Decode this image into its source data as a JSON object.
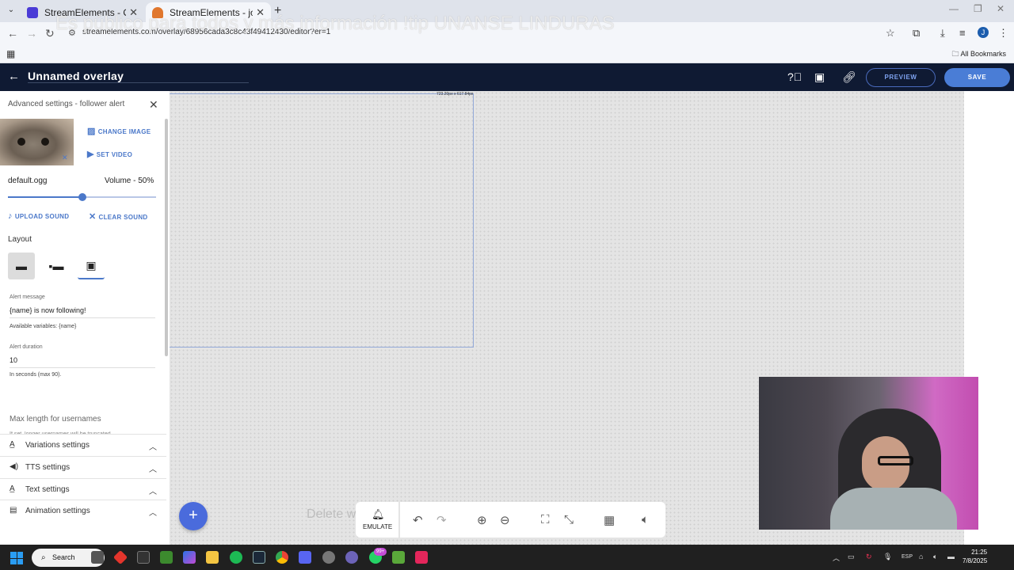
{
  "browser": {
    "tabs": [
      {
        "title": "StreamElements - Overlays",
        "favicon_color": "#4a3bd6"
      },
      {
        "title": "StreamElements - jorgitomix",
        "favicon_color": "#e0772e"
      }
    ],
    "new_tab": "+",
    "url": "streamelements.com/overlay/68956cada3c8c43f49412430/editor?er=1",
    "overlay_banner": "Es público para todos y más información !tip UNANSE LINDURAS",
    "bookmarks": {
      "all_label": "All Bookmarks"
    },
    "profile_initial": "J"
  },
  "app": {
    "overlay_title": "Unnamed overlay",
    "preview_label": "PREVIEW",
    "save_label": "SAVE"
  },
  "panel": {
    "title": "Advanced settings - follower alert",
    "change_image": "CHANGE IMAGE",
    "set_video": "SET VIDEO",
    "sound_name": "default.ogg",
    "volume_label": "Volume - 50%",
    "volume_fraction": 0.5,
    "upload_sound": "UPLOAD SOUND",
    "clear_sound": "CLEAR SOUND",
    "layout_heading": "Layout",
    "alert_message_label": "Alert message",
    "alert_message_value": "{name} is now following!",
    "alert_message_hint": "Available variables: {name}",
    "alert_duration_label": "Alert duration",
    "alert_duration_value": "10",
    "alert_duration_hint": "In seconds (max 90).",
    "max_length_label": "Max length for usernames",
    "max_length_hint": "If set, longer usernames will be truncated",
    "sections": [
      {
        "label": "Variations settings",
        "icon": "text-icon"
      },
      {
        "label": "TTS settings",
        "icon": "speaker-icon"
      },
      {
        "label": "Text settings",
        "icon": "text-icon"
      },
      {
        "label": "Animation settings",
        "icon": "animation-icon"
      }
    ]
  },
  "canvas": {
    "widget_size": "723.20px x 617.84px",
    "delete_watermark": "Delete w"
  },
  "bottom_toolbar": {
    "emulate_label": "EMULATE"
  },
  "taskbar": {
    "search_label": "Search",
    "badge": "99+",
    "lang": "ESP",
    "time": "21:25",
    "date": "7/8/2025"
  }
}
